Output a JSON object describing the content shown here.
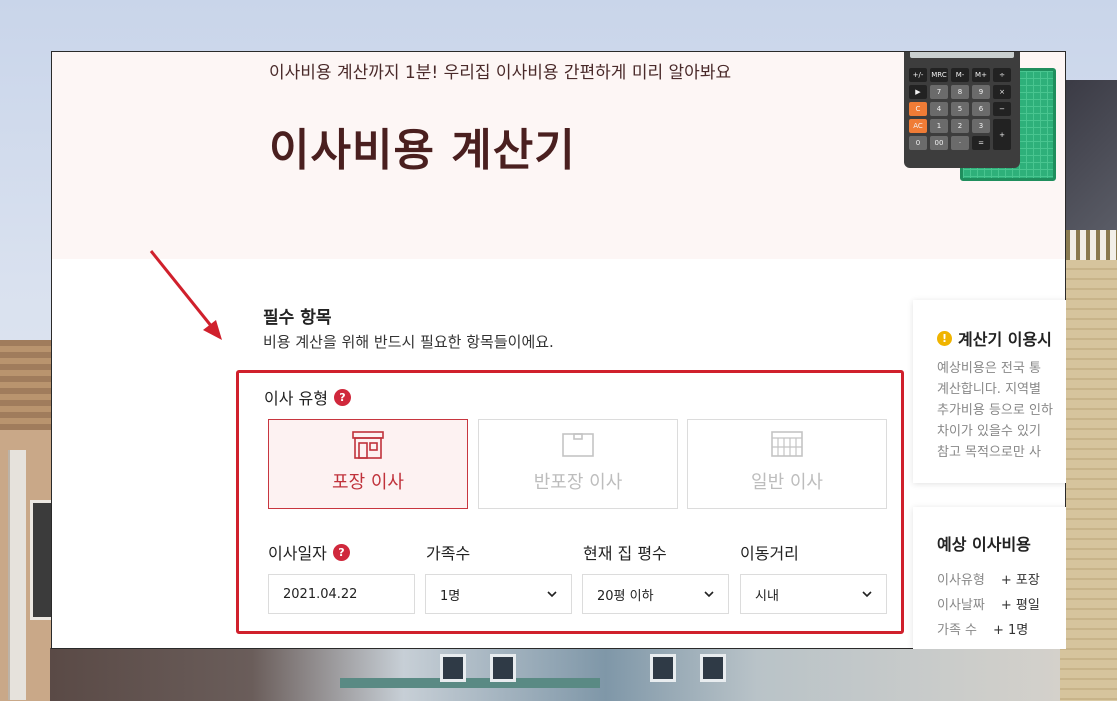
{
  "hero": {
    "intro": "이사비용 계산까지 1분! 우리집 이사비용 간편하게 미리 알아봐요",
    "title": "이사비용 계산기"
  },
  "calculator_keys": [
    "+/-",
    "MRC",
    "M-",
    "M+",
    "÷",
    "▶",
    "7",
    "8",
    "9",
    "×",
    "C",
    "4",
    "5",
    "6",
    "−",
    "AC",
    "1",
    "2",
    "3",
    "+",
    "0",
    "00",
    "·",
    "="
  ],
  "required": {
    "title": "필수 항목",
    "desc": "비용 계산을 위해 반드시 필요한 항목들이에요."
  },
  "move_type": {
    "label": "이사 유형",
    "help": "?",
    "options": [
      {
        "label": "포장 이사",
        "icon": "house-icon",
        "selected": true
      },
      {
        "label": "반포장 이사",
        "icon": "box-icon",
        "selected": false
      },
      {
        "label": "일반 이사",
        "icon": "truck-icon",
        "selected": false
      }
    ]
  },
  "fields": {
    "date": {
      "label": "이사일자",
      "value": "2021.04.22",
      "help": "?"
    },
    "family": {
      "label": "가족수",
      "value": "1명"
    },
    "size": {
      "label": "현재 집 평수",
      "value": "20평 이하"
    },
    "distance": {
      "label": "이동거리",
      "value": "시내"
    }
  },
  "notice": {
    "icon": "warning-icon",
    "warn": "!",
    "title": "계산기 이용시",
    "body": "예상비용은 전국 통\n계산합니다. 지역별\n추가비용 등으로 인하\n차이가 있을수 있기\n참고 목적으로만 사"
  },
  "estimate": {
    "title": "예상 이사비용",
    "rows": [
      {
        "label": "이사유형",
        "value": "+ 포장"
      },
      {
        "label": "이사날짜",
        "value": "+ 평일"
      },
      {
        "label": "가족 수",
        "value": "+ 1명"
      }
    ]
  },
  "colors": {
    "accent": "#d0283c",
    "title": "#4a1f1f",
    "highlight": "#d0202c"
  }
}
